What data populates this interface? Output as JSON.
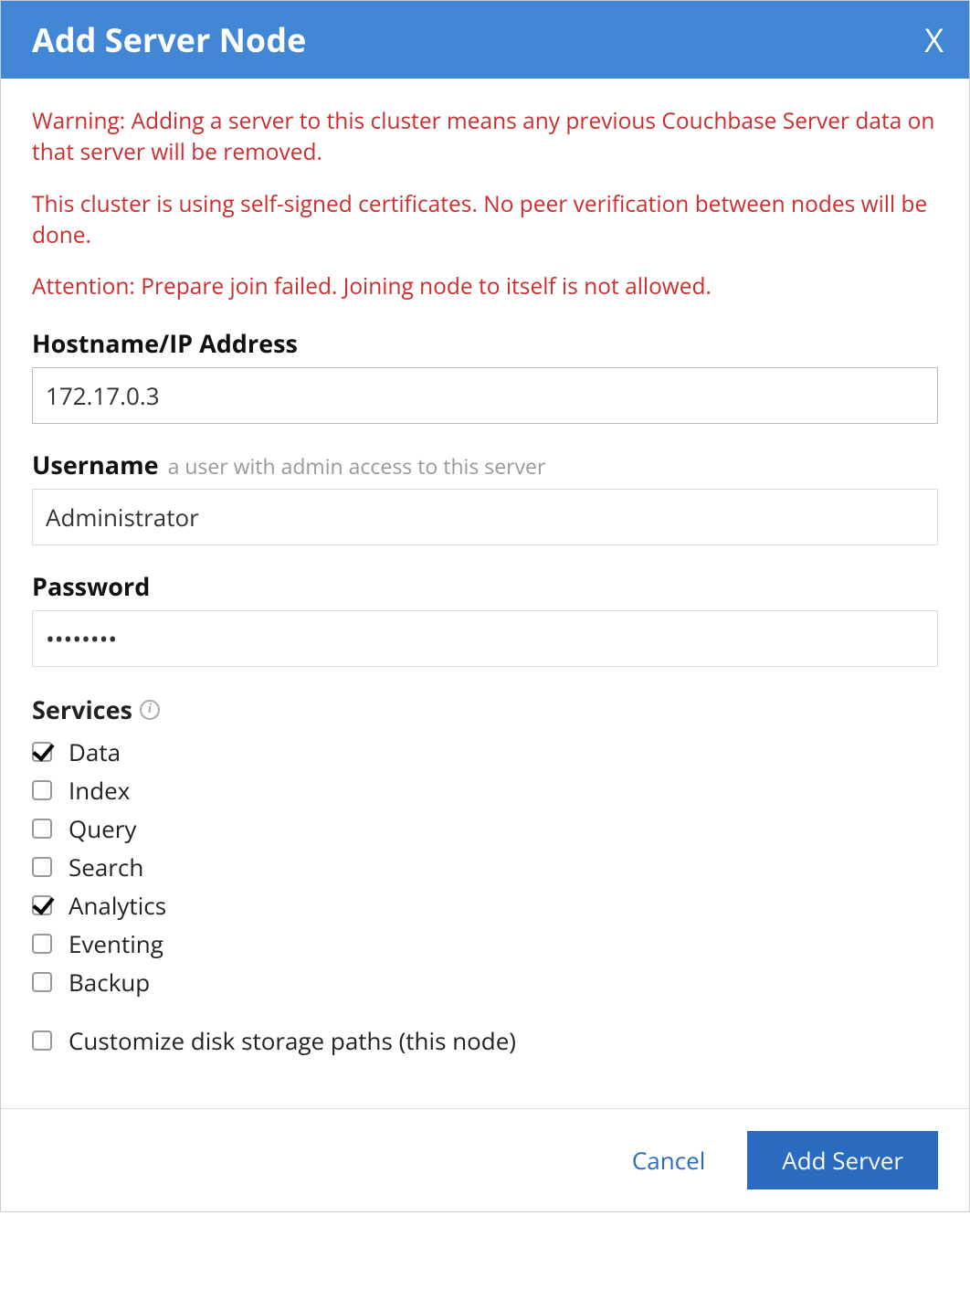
{
  "dialog": {
    "title": "Add Server Node"
  },
  "warnings": {
    "w1": "Warning: Adding a server to this cluster means any previous Couchbase Server data on that server will be removed.",
    "w2": "This cluster is using self-signed certificates. No peer verification between nodes will be done.",
    "w3": "Attention: Prepare join failed. Joining node to itself is not allowed."
  },
  "fields": {
    "hostname_label": "Hostname/IP Address",
    "hostname_value": "172.17.0.3",
    "username_label": "Username",
    "username_hint": "a user with admin access to this server",
    "username_value": "Administrator",
    "password_label": "Password",
    "password_value": "••••••••"
  },
  "services": {
    "label": "Services",
    "items": {
      "data": "Data",
      "index": "Index",
      "query": "Query",
      "search": "Search",
      "analytics": "Analytics",
      "eventing": "Eventing",
      "backup": "Backup"
    },
    "checked": {
      "data": true,
      "index": false,
      "query": false,
      "search": false,
      "analytics": true,
      "eventing": false,
      "backup": false
    }
  },
  "customize": {
    "label": "Customize disk storage paths (this node)",
    "checked": false
  },
  "footer": {
    "cancel": "Cancel",
    "submit": "Add Server"
  }
}
